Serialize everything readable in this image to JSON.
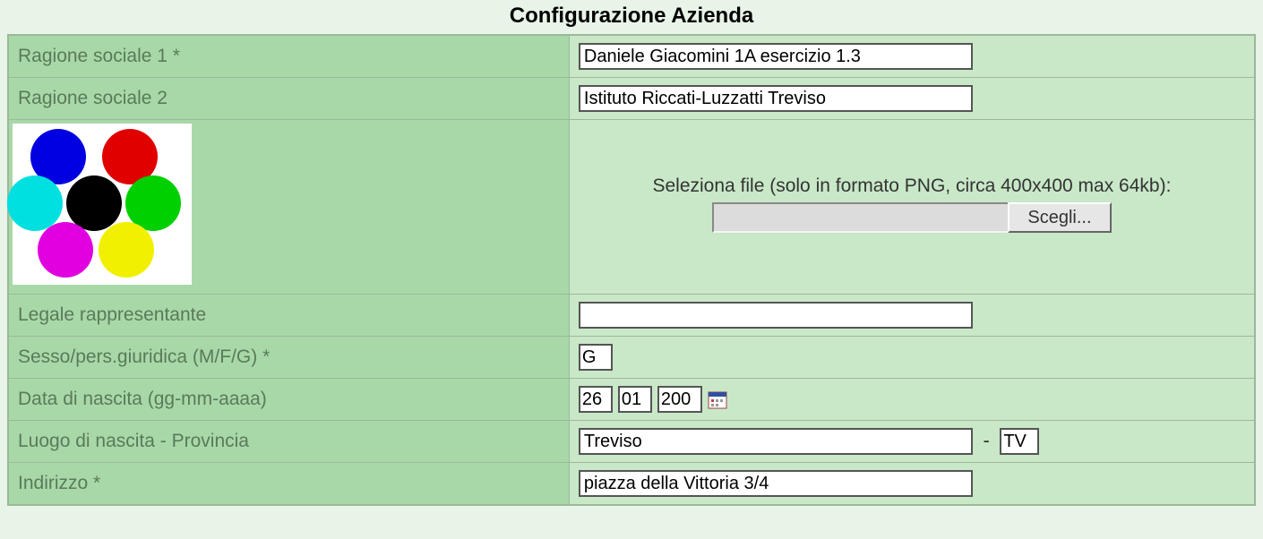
{
  "title": "Configurazione Azienda",
  "fields": {
    "ragione1": {
      "label": "Ragione sociale 1 *",
      "value": "Daniele Giacomini 1A esercizio 1.3"
    },
    "ragione2": {
      "label": "Ragione sociale 2",
      "value": "Istituto Riccati-Luzzatti Treviso"
    },
    "file": {
      "hint": "Seleziona file (solo in formato PNG, circa 400x400 max 64kb):",
      "button": "Scegli...",
      "value": ""
    },
    "legale": {
      "label": "Legale rappresentante",
      "value": ""
    },
    "sesso": {
      "label": "Sesso/pers.giuridica (M/F/G) *",
      "value": "G"
    },
    "data_nascita": {
      "label": "Data di nascita (gg-mm-aaaa)",
      "day": "26",
      "month": "01",
      "year": "200"
    },
    "luogo": {
      "label": "Luogo di nascita - Provincia",
      "city": "Treviso",
      "prov": "TV",
      "sep": "-"
    },
    "indirizzo": {
      "label": "Indirizzo *",
      "value": "piazza della Vittoria 3/4"
    }
  },
  "logo_colors": [
    "#0000e0",
    "#e00000",
    "#00e0e0",
    "#000000",
    "#00d000",
    "#e000e0",
    "#f0f000"
  ]
}
